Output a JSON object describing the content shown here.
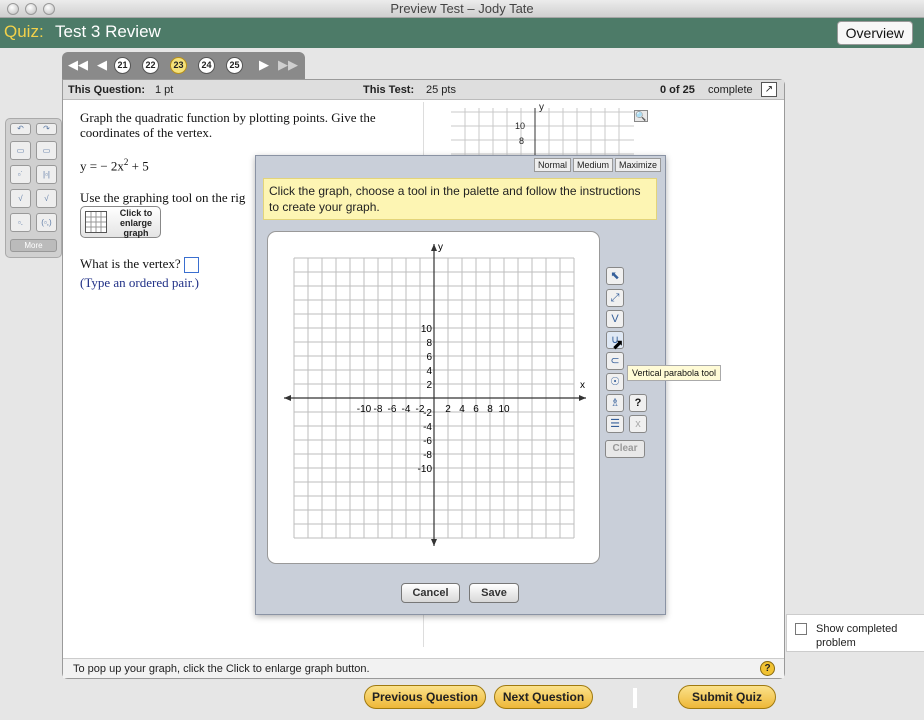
{
  "window": {
    "title": "Preview Test – Jody Tate"
  },
  "header": {
    "quiz_label": "Quiz:",
    "quiz_title": "Test 3 Review",
    "overview_label": "Overview"
  },
  "nav": {
    "question_numbers": [
      "21",
      "22",
      "23",
      "24",
      "25"
    ],
    "current": "23"
  },
  "info": {
    "this_question_label": "This Question:",
    "this_question_value": "1 pt",
    "this_test_label": "This Test:",
    "this_test_value": "25 pts",
    "progress_value": "0 of 25",
    "progress_label": "complete"
  },
  "left_tools": {
    "more_label": "More"
  },
  "question": {
    "prompt": "Graph the quadratic function by plotting points. Give the coordinates of the vertex.",
    "equation_lead": "y = − 2x",
    "equation_exp": "2",
    "equation_tail": " + 5",
    "graph_instruction": "Use the graphing tool on the rig",
    "enlarge_label": "Click to enlarge graph",
    "vertex_question": "What is the vertex?",
    "vertex_hint": "(Type an ordered pair.)"
  },
  "dialog": {
    "size_buttons": [
      "Normal",
      "Medium",
      "Maximize"
    ],
    "instructions": "Click the graph, choose a tool in the palette and follow the instructions to create your graph.",
    "tooltip": "Vertical parabola tool",
    "clear_label": "Clear",
    "help_label": "?",
    "delete_label": "x",
    "cancel_label": "Cancel",
    "save_label": "Save"
  },
  "graph": {
    "x_label": "x",
    "y_label": "y",
    "x_ticks": [
      "-10",
      "-8",
      "-6",
      "-4",
      "-2",
      "2",
      "4",
      "6",
      "8",
      "10"
    ],
    "y_ticks": [
      "10",
      "8",
      "6",
      "4",
      "2",
      "-2",
      "-4",
      "-6",
      "-8",
      "-10"
    ]
  },
  "small_graph": {
    "y_label": "y",
    "y_ticks": [
      "10",
      "8"
    ]
  },
  "footer": {
    "text": "To pop up your graph, click the Click to enlarge graph button.",
    "help_label": "?"
  },
  "show_completed": {
    "label": "Show completed problem"
  },
  "bottom_buttons": {
    "previous": "Previous Question",
    "next": "Next Question",
    "submit": "Submit Quiz"
  }
}
